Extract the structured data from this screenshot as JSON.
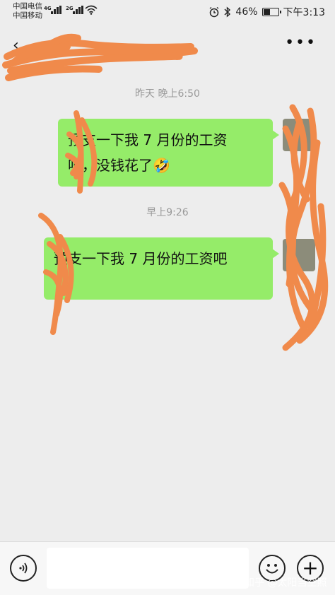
{
  "statusbar": {
    "carrier1": "中国电信",
    "carrier2": "中国移动",
    "net1": "4G",
    "net2": "2G",
    "battery_percent": "46%",
    "battery_level": 0.46,
    "time": "下午3:13"
  },
  "navbar": {
    "back_icon": "‹",
    "title": "一",
    "more_icon": "•••"
  },
  "messages": [
    {
      "time": "昨天 晚上6:50",
      "lines": [
        "预支一下我 7 月份的工资",
        "吧，没钱花了🤣"
      ]
    },
    {
      "time": "早上9:26",
      "lines": [
        "预支一下我 7 月份的工资吧"
      ]
    }
  ],
  "bottombar": {
    "input_value": "",
    "plus_label": "+"
  },
  "watermark": "知乎 @太阳当空照",
  "colors": {
    "bubble": "#95ec69",
    "scribble": "#f08a4b",
    "background": "#ededed"
  }
}
